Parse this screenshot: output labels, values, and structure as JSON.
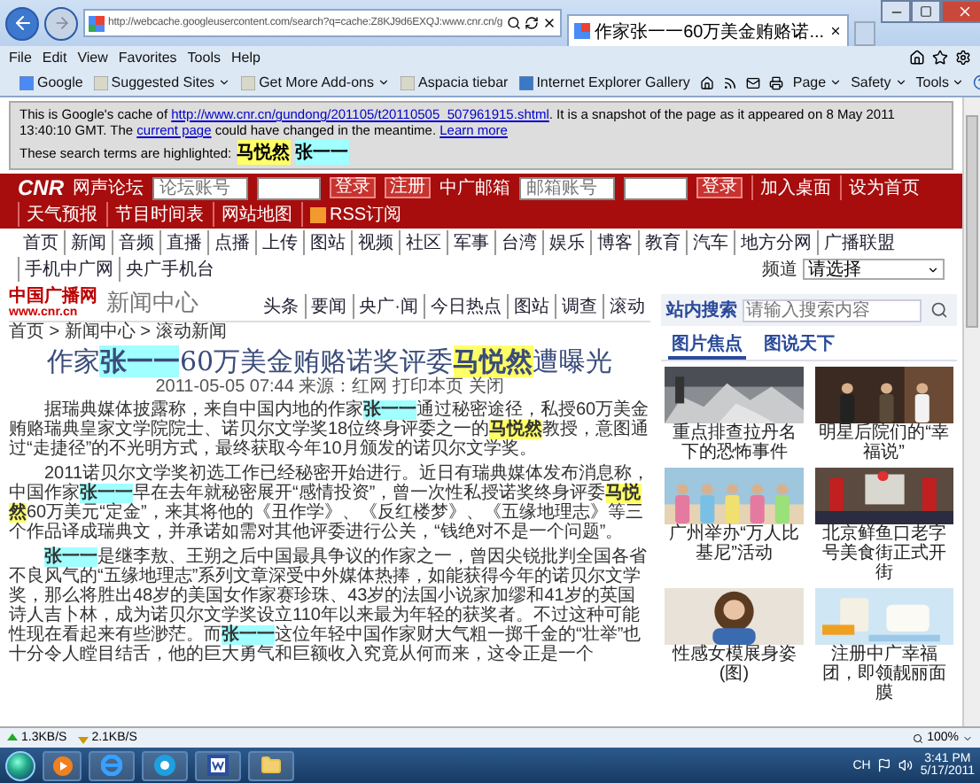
{
  "browser": {
    "address": "http://webcache.googleusercontent.com/search?q=cache:Z8KJ9d6EXQJ:www.cnr.cn/g",
    "tab_title": "作家张一一60万美金贿赂诺...",
    "menu": [
      "File",
      "Edit",
      "View",
      "Favorites",
      "Tools",
      "Help"
    ],
    "favorites": [
      {
        "label": "Google",
        "dropdown": false
      },
      {
        "label": "Suggested Sites",
        "dropdown": true
      },
      {
        "label": "Get More Add-ons",
        "dropdown": true
      },
      {
        "label": "Aspacia tiebar",
        "dropdown": false
      },
      {
        "label": "Internet Explorer Gallery",
        "dropdown": false
      }
    ],
    "commands": [
      "Page",
      "Safety",
      "Tools"
    ]
  },
  "cache_notice": {
    "lead": "This is Google's cache of ",
    "url": "http://www.cnr.cn/gundong/201105/t20110505_507961915.shtml",
    "middle": ". It is a snapshot of the page as it appeared on 8 May 2011 13:40:10 GMT. The ",
    "current_link": "current page",
    "tail": " could have changed in the meantime. ",
    "learn_more": "Learn more",
    "terms_label": "These search terms are highlighted:",
    "terms": [
      {
        "text": "马悦然",
        "color": "#ffff66"
      },
      {
        "text": "张一一",
        "color": "#a0ffff"
      }
    ]
  },
  "site_bar": {
    "logo": "CNR",
    "forum_label": "网声论坛",
    "forum_placeholder": "论坛账号",
    "buttons": [
      "登录",
      "注册"
    ],
    "mail_label": "中广邮箱",
    "mail_placeholder": "邮箱账号",
    "mail_button": "登录",
    "links": [
      "加入桌面",
      "设为首页",
      "天气预报",
      "节目时间表",
      "网站地图",
      "RSS订阅"
    ]
  },
  "nav": {
    "items": [
      "首页",
      "新闻",
      "音频",
      "直播",
      "点播",
      "上传",
      "图站",
      "视频",
      "社区",
      "军事",
      "台湾",
      "娱乐",
      "博客",
      "教育",
      "汽车",
      "地方分网",
      "广播联盟",
      "手机中广网",
      "央广手机台"
    ],
    "channel_label": "频道",
    "channel_value": "请选择"
  },
  "article": {
    "site_name": "中国广播网",
    "site_url": "www.cnr.cn",
    "section": "新闻中心",
    "section_links": [
      "头条",
      "要闻",
      "央广·闻",
      "今日热点",
      "图站",
      "调查",
      "滚动"
    ],
    "breadcrumb": "首页 > 新闻中心 > 滚动新闻",
    "headline": [
      {
        "text": "作家"
      },
      {
        "text": "张一一",
        "color": "#a0ffff"
      },
      {
        "text": "60万美金贿赂诺奖评委"
      },
      {
        "text": "马悦然",
        "color": "#ffff66"
      },
      {
        "text": "遭曝光"
      }
    ],
    "byline": "2011-05-05 07:44  来源：红网  打印本页  关闭",
    "paragraphs": [
      [
        {
          "text": "据瑞典媒体披露称，来自中国内地的作家"
        },
        {
          "text": "张一一",
          "color": "#a0ffff"
        },
        {
          "text": "通过秘密途径，私授60万美金贿赂瑞典皇家文学院院士、诺贝尔文学奖18位终身评委之一的"
        },
        {
          "text": "马悦然",
          "color": "#ffff66"
        },
        {
          "text": "教授，意图通过“走捷径”的不光明方式，最终获取今年10月颁发的诺贝尔文学奖。"
        }
      ],
      [
        {
          "text": "2011诺贝尔文学奖初选工作已经秘密开始进行。近日有瑞典媒体发布消息称，中国作家"
        },
        {
          "text": "张一一",
          "color": "#a0ffff"
        },
        {
          "text": "早在去年就秘密展开“感情投资”，曾一次性私授诺奖终身评委"
        },
        {
          "text": "马悦然",
          "color": "#ffff66"
        },
        {
          "text": "60万美元“定金”，来其将他的《丑作学》、《反红楼梦》、《五缘地理志》等三个作品译成瑞典文，并承诺如需对其他评委进行公关，“钱绝对不是一个问题”。"
        }
      ],
      [
        {
          "text": "张一一",
          "color": "#a0ffff"
        },
        {
          "text": "是继李敖、王朔之后中国最具争议的作家之一，曾因尖锐批判全国各省不良风气的“五缘地理志”系列文章深受中外媒体热捧，如能获得今年的诺贝尔文学奖，那么将胜出48岁的美国女作家赛珍珠、43岁的法国小说家加缪和41岁的英国诗人吉卜林，成为诺贝尔文学奖设立110年以来最为年轻的获奖者。不过这种可能性现在看起来有些渺茫。而"
        },
        {
          "text": "张一一",
          "color": "#a0ffff"
        },
        {
          "text": "这位年轻中国作家财大气粗一掷千金的“壮举”也十分令人瞠目结舌，他的巨大勇气和巨额收入究竟从何而来，这令正是一个"
        }
      ]
    ]
  },
  "sidebar": {
    "search_label": "站内搜索",
    "search_placeholder": "请输入搜索内容",
    "tabs": [
      {
        "label": "图片焦点",
        "selected": true
      },
      {
        "label": "图说天下",
        "selected": false
      }
    ],
    "photos": [
      {
        "caption": "重点排查拉丹名下的恐怖事件",
        "kind": "rubble"
      },
      {
        "caption": "明星后院们的“幸福说”",
        "kind": "group"
      },
      {
        "caption": "广州举办“万人比基尼”活动",
        "kind": "beach"
      },
      {
        "caption": "北京鲜鱼口老字号美食街正式开街",
        "kind": "street"
      },
      {
        "caption": "性感女模展身姿(图)",
        "kind": "portrait"
      },
      {
        "caption": "注册中广幸福团，即领靓丽面膜",
        "kind": "product"
      }
    ]
  },
  "status_bar": {
    "upload": "1.3KB/S",
    "download": "2.1KB/S",
    "zoom": "100%"
  },
  "taskbar": {
    "input_language": "CH",
    "time": "3:41 PM",
    "date": "5/17/2011"
  }
}
